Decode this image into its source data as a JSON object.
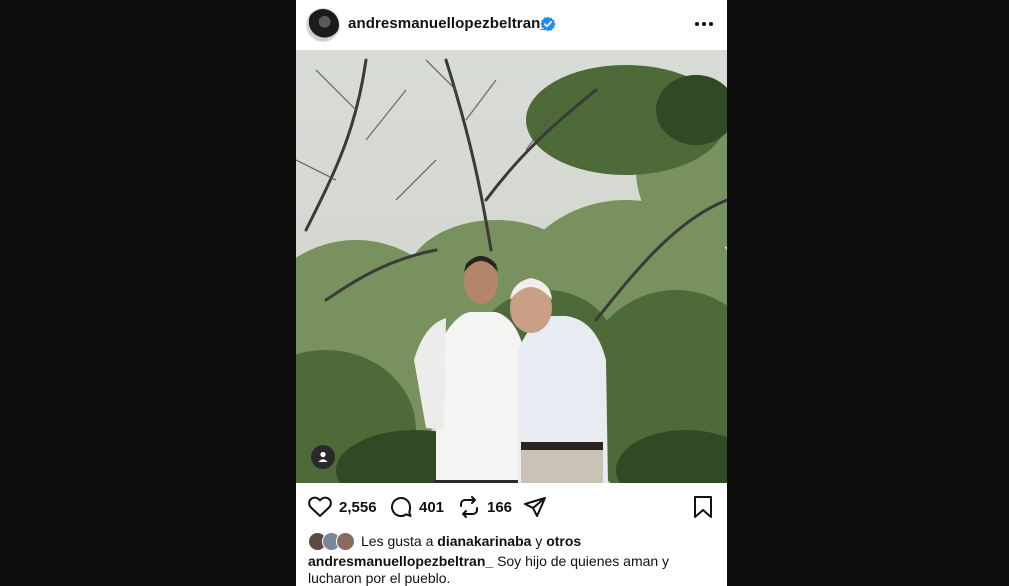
{
  "post": {
    "username": "andresmanuellopezbeltran_",
    "verified_icon": "verified-badge-icon",
    "more_icon": "more-options-icon",
    "accent_color": "#1f8ef1"
  },
  "actions": {
    "likes_count": "2,556",
    "comments_count": "401",
    "reposts_count": "166"
  },
  "liked_by": {
    "prefix": "Les gusta a",
    "name": "dianakarinaba",
    "joiner": "y",
    "others": "otros"
  },
  "caption": {
    "author": "andresmanuellopezbeltran_",
    "text": "Soy hijo de quienes aman y lucharon por el pueblo."
  }
}
